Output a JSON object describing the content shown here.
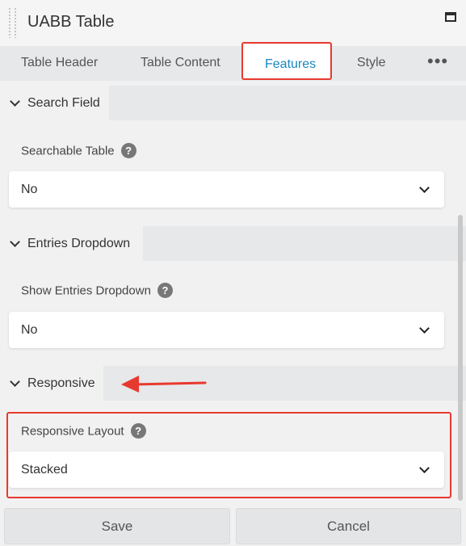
{
  "window": {
    "title": "UABB Table"
  },
  "tabs": [
    {
      "label": "Table Header"
    },
    {
      "label": "Table Content"
    },
    {
      "label": "Features",
      "active": true
    },
    {
      "label": "Style"
    }
  ],
  "more_label": "•••",
  "sections": [
    {
      "title": "Search Field",
      "field_label": "Searchable Table",
      "value": "No"
    },
    {
      "title": "Entries Dropdown",
      "field_label": "Show Entries Dropdown",
      "value": "No"
    },
    {
      "title": "Responsive",
      "field_label": "Responsive Layout",
      "value": "Stacked"
    }
  ],
  "help_glyph": "?",
  "footer": {
    "save_label": "Save",
    "cancel_label": "Cancel"
  },
  "colors": {
    "accent": "#1a87c0",
    "annotation": "#e8392f"
  }
}
